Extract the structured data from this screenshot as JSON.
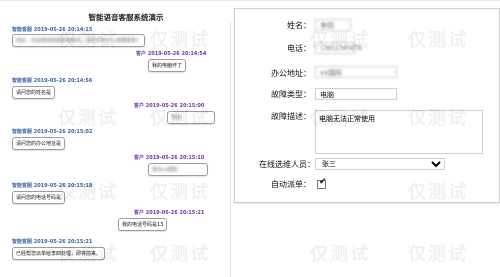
{
  "chat": {
    "title": "智能语音客服系统演示",
    "messages": [
      {
        "side": "left",
        "meta": "智能客服 2019-05-26 20:14:15",
        "text": "您好，欢迎使用智能报修服务，请问您有什么需要帮助？",
        "blurred": true
      },
      {
        "side": "right",
        "meta": "客户 2019-05-26 20:14:54",
        "text": "我的电脑坏了",
        "blurred": false
      },
      {
        "side": "left",
        "meta": "智能客服 2019-05-26 20:14:56",
        "text": "请问您的姓名是",
        "blurred": false
      },
      {
        "side": "right",
        "meta": "客户 2019-05-26 20:15:00",
        "text": "李四",
        "blurred": true
      },
      {
        "side": "left",
        "meta": "智能客服 2019-05-26 20:15:02",
        "text": "请问您的办公地址是",
        "blurred": false
      },
      {
        "side": "right",
        "meta": "客户 2019-05-26 20:15:10",
        "text": "我在xx国际",
        "blurred": true
      },
      {
        "side": "left",
        "meta": "智能客服 2019-05-26 20:15:18",
        "text": "请问您的电话号码是",
        "blurred": false
      },
      {
        "side": "right",
        "meta": "客户 2019-05-26 20:15:21",
        "text": "我的电话号码是13",
        "blurred": false
      },
      {
        "side": "left",
        "meta": "智能客服 2019-05-26 20:15:21",
        "text": "已经帮您派单给李四处理，即将前来。",
        "blurred": false
      }
    ]
  },
  "form": {
    "name_label": "姓名：",
    "name_value": "李四",
    "phone_label": "电话：",
    "phone_value": "13812345678",
    "office_label": "办公地址：",
    "office_value": "xx国际",
    "fault_type_label": "故障类型：",
    "fault_type_value": "电脑",
    "fault_desc_label": "故障描述：",
    "fault_desc_value": "电脑无法正常使用",
    "online_staff_label": "在线选维人员：",
    "online_staff_value": "张三",
    "auto_dispatch_label": "自动派单：",
    "auto_dispatch_checked": true
  },
  "watermark": "仅测试"
}
